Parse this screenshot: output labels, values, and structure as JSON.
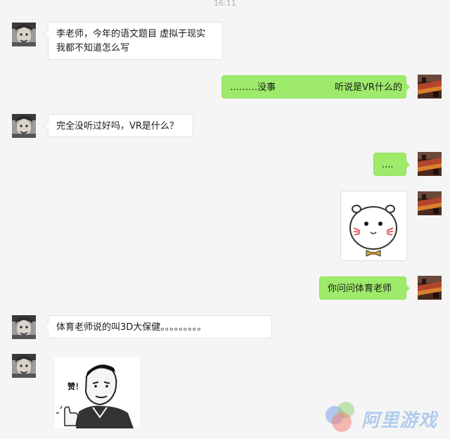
{
  "header": {
    "timestamp": "16:11"
  },
  "messages": [
    {
      "id": 1,
      "side": "left",
      "lines": [
        "李老师，今年的语文题目 虚拟于现实",
        "我都不知道怎么写"
      ]
    },
    {
      "id": 2,
      "side": "right",
      "part1": "………没事",
      "part2": "听说是VR什么的"
    },
    {
      "id": 3,
      "side": "left",
      "text": "完全没听过好吗，VR是什么？"
    },
    {
      "id": 4,
      "side": "right",
      "text": "...."
    },
    {
      "id": 5,
      "side": "right",
      "sticker": "blush-bun-face-sticker"
    },
    {
      "id": 6,
      "side": "right",
      "text": "你问问体育老师"
    },
    {
      "id": 7,
      "side": "left",
      "text": "体育老师说的叫3D大保健。。。。。。。。。"
    },
    {
      "id": 8,
      "side": "left",
      "sticker": "thumbs-up-meme-sticker",
      "caption": "赞！"
    }
  ],
  "watermark": {
    "text": "阿里游戏"
  },
  "colors": {
    "background": "#f5f5f5",
    "bubble_right": "#9eea6a",
    "bubble_left": "#ffffff",
    "timestamp": "#b2b2b2"
  }
}
